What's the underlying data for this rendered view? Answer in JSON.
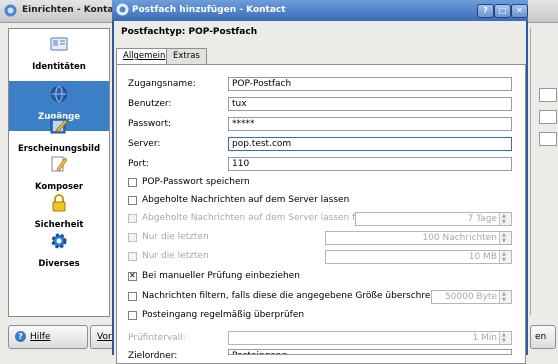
{
  "bg_window": {
    "title": "Einrichten - Kontact",
    "sidebar": [
      {
        "label": "Identitäten",
        "icon": "identity-card-icon",
        "selected": false
      },
      {
        "label": "Zugänge",
        "icon": "network-globe-icon",
        "selected": true
      },
      {
        "label": "Erscheinungsbild",
        "icon": "appearance-icon",
        "selected": false
      },
      {
        "label": "Komposer",
        "icon": "composer-pen-icon",
        "selected": false
      },
      {
        "label": "Sicherheit",
        "icon": "padlock-icon",
        "selected": false
      },
      {
        "label": "Diverses",
        "icon": "gear-icon",
        "selected": false
      }
    ],
    "help_button": "Hilfe",
    "preset_button": "Vorein",
    "right_button": "en"
  },
  "dialog": {
    "title": "Postfach hinzufügen - Kontact",
    "title_buttons": [
      "?",
      "□",
      "✕"
    ],
    "type_label": "Postfachtyp: POP-Postfach",
    "tabs": [
      {
        "label": "Allgemein",
        "active": true
      },
      {
        "label": "Extras",
        "active": false
      }
    ],
    "fields": [
      {
        "label": "Zugangsname:",
        "value": "POP-Postfach"
      },
      {
        "label": "Benutzer:",
        "value": "tux"
      },
      {
        "label": "Passwort:",
        "value": "*****"
      },
      {
        "label": "Server:",
        "value": "pop.test.com"
      },
      {
        "label": "Port:",
        "value": "110"
      }
    ],
    "checkboxes": [
      {
        "label": "POP-Passwort speichern",
        "checked": false,
        "enabled": true
      },
      {
        "label": "Abgeholte Nachrichten auf dem Server lassen",
        "checked": false,
        "enabled": true
      },
      {
        "label": "Abgeholte Nachrichten auf dem Server lassen für",
        "checked": false,
        "enabled": false,
        "spin_value": "7 Tage"
      },
      {
        "label": "Nur die letzten",
        "checked": false,
        "enabled": false,
        "spin_value": "100 Nachrichten"
      },
      {
        "label": "Nur die letzten",
        "checked": false,
        "enabled": false,
        "spin_value": "10 MB"
      },
      {
        "label": "Bei manueller Prüfung einbeziehen",
        "checked": true,
        "enabled": true
      },
      {
        "label": "Nachrichten filtern, falls diese die angegebene Größe überschreiten",
        "checked": false,
        "enabled": true,
        "spin_value": "50000 Byte"
      },
      {
        "label": "Posteingang regelmäßig überprüfen",
        "checked": false,
        "enabled": true
      }
    ],
    "interval_label": "Prüfintervall:",
    "interval_value": "1 Min",
    "target_label": "Zielordner:",
    "target_value": "Posteingang"
  }
}
